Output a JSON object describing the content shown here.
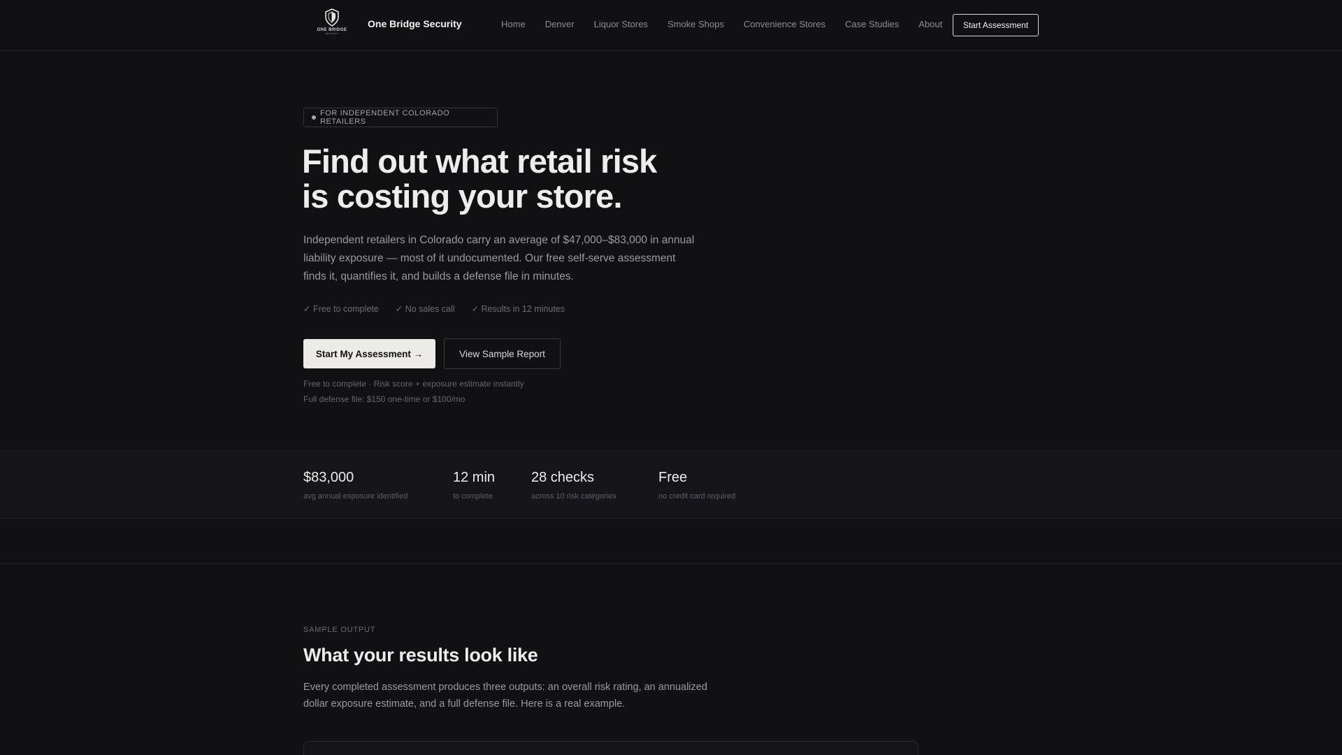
{
  "nav": {
    "logo_text": "ONE BRIDGE",
    "logo_sub": "SECURITY",
    "brand": "One Bridge Security",
    "items": [
      "Home",
      "Denver",
      "Liquor Stores",
      "Smoke Shops",
      "Convenience Stores",
      "Case Studies",
      "About"
    ],
    "cta": "Start Assessment"
  },
  "hero": {
    "badge": "FOR INDEPENDENT COLORADO RETAILERS",
    "title_line1": "Find out what retail risk",
    "title_line2": "is costing your store.",
    "lead": "Independent retailers in Colorado carry an average of $47,000–$83,000 in annual liability exposure — most of it undocumented. Our free self-serve assessment finds it, quantifies it, and builds a defense file in minutes.",
    "checks": [
      "✓ Free to complete",
      "✓ No sales call",
      "✓ Results in 12 minutes"
    ],
    "primary_button": "Start My Assessment →",
    "secondary_button": "View Sample Report",
    "fine_print_1": "Free to complete · Risk score + exposure estimate instantly",
    "fine_print_2": "Full defense file: $150 one-time or $100/mo"
  },
  "stats": [
    {
      "value": "$83,000",
      "label": "avg annual exposure identified"
    },
    {
      "value": "12 min",
      "label": "to complete"
    },
    {
      "value": "28 checks",
      "label": "across 10 risk categories"
    },
    {
      "value": "Free",
      "label": "no credit card required"
    }
  ],
  "sample": {
    "eyebrow": "SAMPLE OUTPUT",
    "title": "What your results look like",
    "lead": "Every completed assessment produces three outputs: an overall risk rating, an annualized dollar exposure estimate, and a full defense file. Here is a real example."
  },
  "colors": {
    "background": "#111113",
    "band": "#16161a",
    "primary_button": "#ecebe7"
  }
}
